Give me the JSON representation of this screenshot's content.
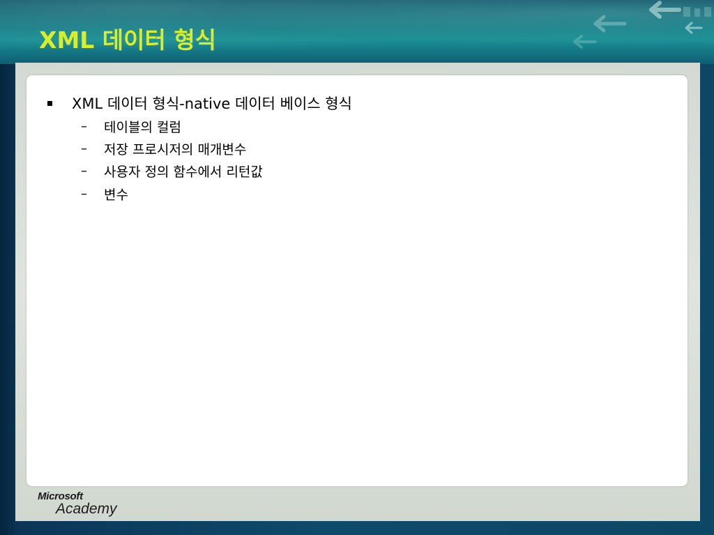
{
  "slide": {
    "title": "XML 데이터 형식",
    "bullets": [
      {
        "text": "XML 데이터 형식-native 데이터 베이스 형식",
        "subitems": [
          "테이블의 컬럼",
          "저장 프로시저의 매개변수",
          "사용자 정의 함수에서 리턴값",
          "변수"
        ]
      }
    ]
  },
  "footer": {
    "logo_line1": "Microsoft",
    "logo_line2": "Academy"
  },
  "colors": {
    "title": "#d8ee2a",
    "header": "#137a86",
    "background": "#0d3a5c",
    "content": "#ffffff",
    "frame": "#dfe5de"
  },
  "icons": {
    "header_decoration": "arrow-left-icon",
    "bullet": "square-bullet-icon"
  }
}
